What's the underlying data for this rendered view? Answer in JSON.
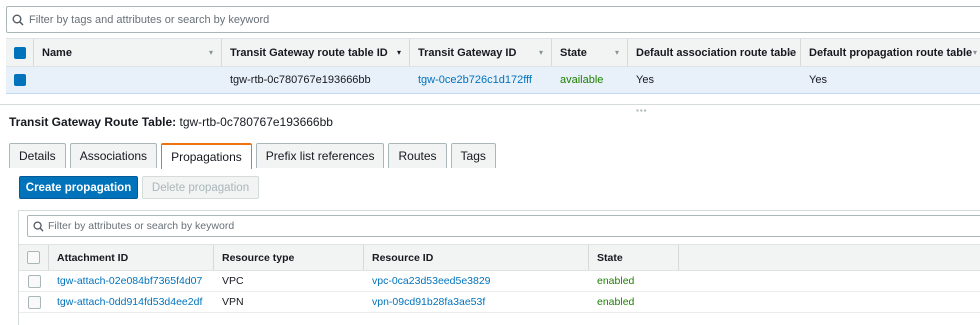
{
  "top_search": {
    "placeholder": "Filter by tags and attributes or search by keyword"
  },
  "top_table": {
    "columns": [
      "Name",
      "Transit Gateway route table ID",
      "Transit Gateway ID",
      "State",
      "Default association route table",
      "Default propagation route table"
    ],
    "row": {
      "name": "",
      "route_table_id": "tgw-rtb-0c780767e193666bb",
      "tgw_id": "tgw-0ce2b726c1d172fff",
      "state": "available",
      "default_association": "Yes",
      "default_propagation": "Yes"
    }
  },
  "detail": {
    "label": "Transit Gateway Route Table:",
    "value": "tgw-rtb-0c780767e193666bb"
  },
  "tabs": [
    "Details",
    "Associations",
    "Propagations",
    "Prefix list references",
    "Routes",
    "Tags"
  ],
  "active_tab": "Propagations",
  "buttons": {
    "create": "Create propagation",
    "delete": "Delete propagation"
  },
  "inner_search": {
    "placeholder": "Filter by attributes or search by keyword"
  },
  "propagations_table": {
    "columns": [
      "Attachment ID",
      "Resource type",
      "Resource ID",
      "State"
    ],
    "rows": [
      {
        "attachment_id": "tgw-attach-02e084bf7365f4d07",
        "resource_type": "VPC",
        "resource_id": "vpc-0ca23d53eed5e3829",
        "state": "enabled"
      },
      {
        "attachment_id": "tgw-attach-0dd914fd53d4ee2df",
        "resource_type": "VPN",
        "resource_id": "vpn-09cd91b28fa3ae53f",
        "state": "enabled"
      }
    ]
  },
  "colors": {
    "link": "#0073bb",
    "enabled": "#1d8102",
    "primary": "#0073bb",
    "active_tab": "#ec7211"
  },
  "icons": {
    "search": "search-icon",
    "sort": "sort-caret-icon",
    "splitter": "drag-handle-icon"
  }
}
